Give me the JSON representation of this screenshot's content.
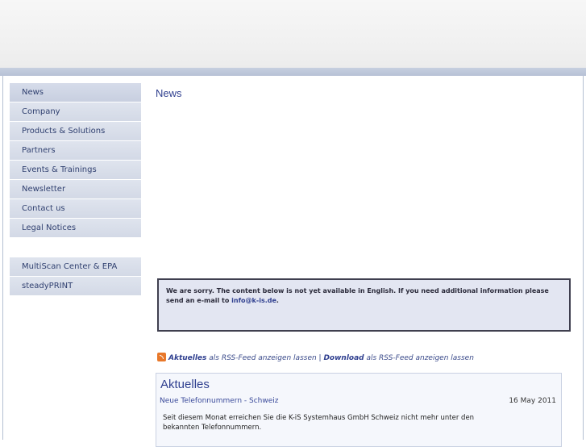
{
  "sidebar": {
    "items": [
      {
        "label": "News"
      },
      {
        "label": "Company"
      },
      {
        "label": "Products & Solutions"
      },
      {
        "label": "Partners"
      },
      {
        "label": "Events & Trainings"
      },
      {
        "label": "Newsletter"
      },
      {
        "label": "Contact us"
      },
      {
        "label": "Legal Notices"
      }
    ],
    "extra_items": [
      {
        "label": "MultiScan Center & EPA"
      },
      {
        "label": "steadyPRINT"
      }
    ]
  },
  "main": {
    "title": "News",
    "notice": {
      "text": "We are sorry. The content below is not yet available in English. If you need additional information please send an e-mail to ",
      "email": "info@k-is.de",
      "end": "."
    },
    "rss": {
      "feed1_label": "Aktuelles",
      "feed1_suffix": " als RSS-Feed anzeigen lassen | ",
      "feed2_label": "Download",
      "feed2_suffix": " als RSS-Feed anzeigen lassen"
    },
    "news_box": {
      "title": "Aktuelles",
      "item_link": "Neue Telefonnummern - Schweiz",
      "item_date": "16 May 2011",
      "item_text": "Seit diesem Monat erreichen Sie die K-iS Systemhaus GmbH Schweiz nicht mehr unter den bekannten Telefonnummern."
    }
  },
  "colors": {
    "accent": "#2f3f8f",
    "nav_bg": "#d3d9e6",
    "rss_orange": "#e8782a"
  }
}
